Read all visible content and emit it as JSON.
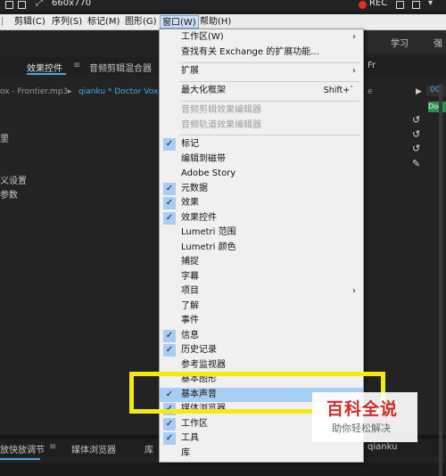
{
  "capture_bar": {
    "size_label": "660x770",
    "rec_label": "REC"
  },
  "menubar": {
    "items": [
      "剪辑(C)",
      "序列(S)",
      "标记(M)",
      "图形(G)",
      "窗口(W)",
      "帮助(H)"
    ]
  },
  "app": {
    "right_tab": "学习",
    "effects_tab": "效果控件",
    "audio_mixer_tab": "音频剪辑混合器",
    "audio_mixer_suffix": "Fr",
    "clip_left": "ox - Frontier.mp3",
    "clip_right": "qianku * Doctor Vox - Fr",
    "side_text_1": "里",
    "side_text_2": "义设置",
    "side_text_3": "参数",
    "bottom_tab_1": "放快放调节",
    "bottom_tab_2": "媒体浏览器",
    "bottom_tab_3": "库",
    "bottom_right_label": "qianku",
    "timeline_marker": "00",
    "green_clip": "Doc",
    "top_right_char": "强"
  },
  "dropdown": {
    "items": [
      {
        "label": "工作区(W)",
        "submenu": true
      },
      {
        "label": "查找有关 Exchange 的扩展功能..."
      },
      {
        "label": "扩展",
        "submenu": true
      },
      {
        "label": "最大化框架",
        "shortcut": "Shift+`"
      },
      {
        "label": "音频剪辑效果编辑器",
        "disabled": true
      },
      {
        "label": "音频轨道效果编辑器",
        "disabled": true
      },
      {
        "label": "标记",
        "checked": true
      },
      {
        "label": "编辑到磁带"
      },
      {
        "label": "Adobe Story"
      },
      {
        "label": "元数据",
        "checked": true
      },
      {
        "label": "效果",
        "checked": true
      },
      {
        "label": "效果控件",
        "checked": true
      },
      {
        "label": "Lumetri 范围"
      },
      {
        "label": "Lumetri 颜色"
      },
      {
        "label": "捕捉"
      },
      {
        "label": "字幕"
      },
      {
        "label": "项目",
        "submenu": true
      },
      {
        "label": "了解"
      },
      {
        "label": "事件"
      },
      {
        "label": "信息",
        "checked": true
      },
      {
        "label": "历史记录",
        "checked": true
      },
      {
        "label": "参考监视器"
      },
      {
        "label": "基本图形"
      },
      {
        "label": "基本声音",
        "checked": true,
        "highlighted": true
      },
      {
        "label": "媒体浏览器",
        "checked": true
      },
      {
        "label": "工作区",
        "checked": true
      },
      {
        "label": "工具",
        "checked": true
      },
      {
        "label": "库"
      }
    ]
  },
  "watermark": {
    "title": "百科全说",
    "subtitle": "助你轻松解决"
  },
  "colors": {
    "menu_bg": "#f0f0f0",
    "check_bg": "#a8cdf3",
    "highlight": "#a8cdf3",
    "annotation": "#f2ea10",
    "app_bg": "#232323"
  }
}
